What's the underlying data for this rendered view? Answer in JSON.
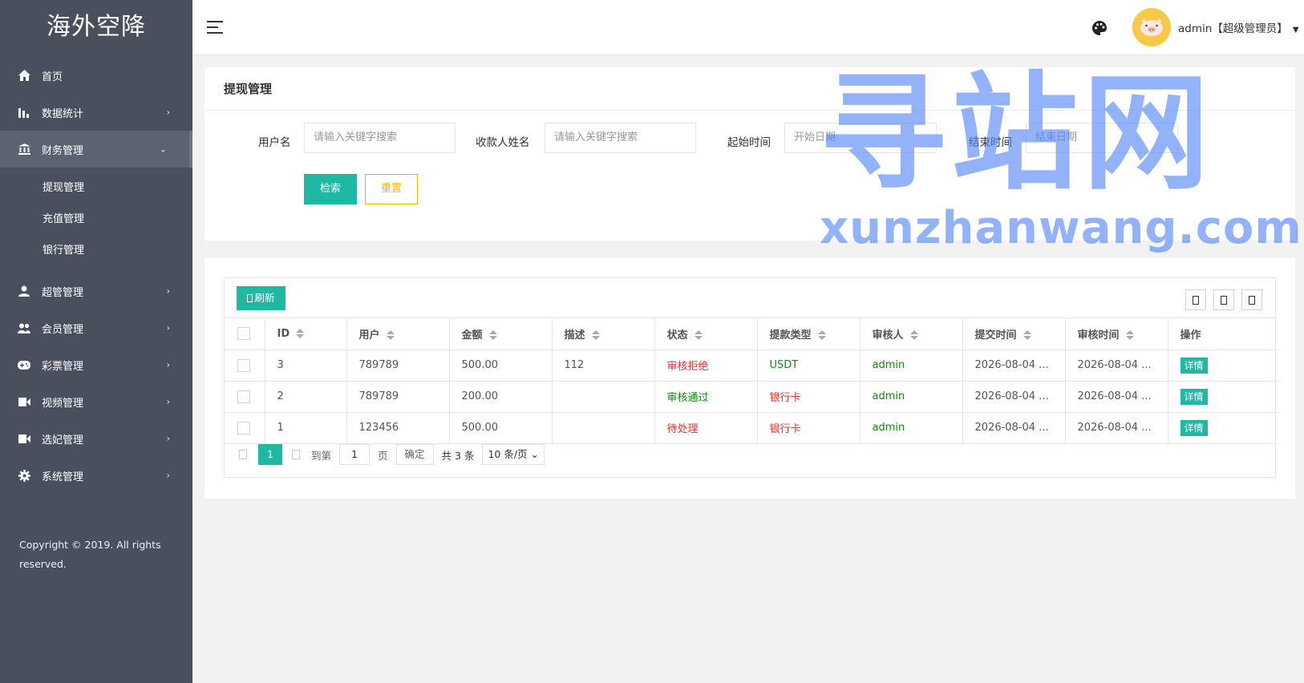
{
  "sidebar": {
    "logo": "海外空降",
    "items": [
      {
        "label": "首页",
        "icon": "home-icon"
      },
      {
        "label": "数据统计",
        "icon": "bar-chart-icon"
      },
      {
        "label": "财务管理",
        "icon": "bank-icon"
      },
      {
        "label": "超管管理",
        "icon": "user-icon"
      },
      {
        "label": "会员管理",
        "icon": "users-icon"
      },
      {
        "label": "彩票管理",
        "icon": "gamepad-icon"
      },
      {
        "label": "视频管理",
        "icon": "video-icon"
      },
      {
        "label": "选妃管理",
        "icon": "video-icon"
      },
      {
        "label": "系统管理",
        "icon": "gear-icon"
      }
    ],
    "sub_items": [
      "提现管理",
      "充值管理",
      "银行管理"
    ],
    "copyright": "Copyright © 2019. All rights reserved."
  },
  "header": {
    "user_label": "admin【超级管理员】"
  },
  "search": {
    "title": "提现管理",
    "username_label": "用户名",
    "username_placeholder": "请输入关键字搜索",
    "payee_label": "收款人姓名",
    "payee_placeholder": "请输入关键字搜索",
    "start_label": "起始时间",
    "start_placeholder": "开始日期",
    "end_label": "结束时间",
    "end_placeholder": "结束日期",
    "search_btn": "检索",
    "reset_btn": "重置"
  },
  "table": {
    "refresh_btn": "刷新",
    "columns": [
      "ID",
      "用户",
      "金额",
      "描述",
      "状态",
      "提款类型",
      "审核人",
      "提交时间",
      "审核时间",
      "操作"
    ],
    "rows": [
      {
        "id": "3",
        "user": "789789",
        "amount": "500.00",
        "desc": "112",
        "status": "审核拒绝",
        "type": "USDT",
        "reviewer": "admin",
        "submit": "2026-08-04 ...",
        "review": "2026-08-04 ...",
        "action": "详情"
      },
      {
        "id": "2",
        "user": "789789",
        "amount": "200.00",
        "desc": "",
        "status": "审核通过",
        "type": "银行卡",
        "reviewer": "admin",
        "submit": "2026-08-04 ...",
        "review": "2026-08-04 ...",
        "action": "详情"
      },
      {
        "id": "1",
        "user": "123456",
        "amount": "500.00",
        "desc": "",
        "status": "待处理",
        "type": "银行卡",
        "reviewer": "admin",
        "submit": "2026-08-04 ...",
        "review": "2026-08-04 ...",
        "action": "详情"
      }
    ]
  },
  "pager": {
    "current": "1",
    "goto_label": "到第",
    "goto_value": "1",
    "page_unit": "页",
    "confirm": "确定",
    "total": "共 3 条",
    "page_size": "10 条/页"
  },
  "watermark": {
    "big": "寻站网",
    "small": "xunzhanwang.com"
  },
  "colors": {
    "sidebar_bg": "#48505e",
    "accent": "#1eb8a3",
    "reset": "#f0b400",
    "status_red": "#ff2a2a",
    "status_green": "#0a8f0a"
  }
}
